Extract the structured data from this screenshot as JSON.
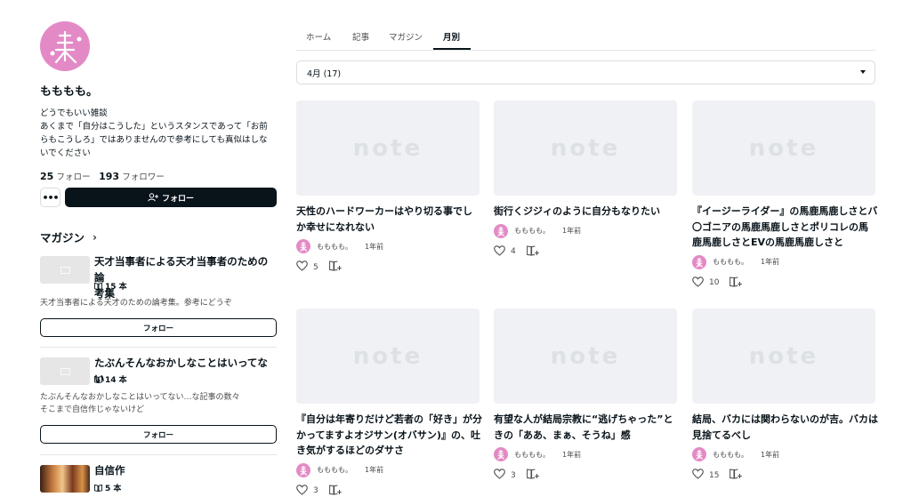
{
  "profile": {
    "name": "もももも。",
    "bio": [
      "どうでもいい雑談",
      "あくまで「自分はこうした」というスタンスであって「お前",
      "らもこうしろ」ではありませんので参考にしても真似はしな",
      "いでください"
    ],
    "following_count": "25",
    "following_label": "フォロー",
    "follower_count": "193",
    "follower_label": "フォロワー",
    "more_label": "•••",
    "follow_label": "フォロー"
  },
  "magazines": {
    "heading": "マガジン",
    "items": [
      {
        "title": [
          "天才当事者による天才当事者のための論",
          "考集"
        ],
        "count": "15 本",
        "desc": [
          "天才当事者による天才のための論考集。参考にどうぞ"
        ],
        "follow_label": "フォロー"
      },
      {
        "title": [
          "たぶんそんなおかしなことはいってない"
        ],
        "count": "14 本",
        "desc": [
          "たぶんそんなおかしなことはいってない…な記事の数々",
          "そこまで自信作じゃないけど"
        ],
        "follow_label": "フォロー"
      },
      {
        "title": [
          "自信作"
        ],
        "count": "5 本"
      }
    ]
  },
  "tabs": [
    {
      "label": "ホーム"
    },
    {
      "label": "記事"
    },
    {
      "label": "マガジン"
    },
    {
      "label": "月別"
    }
  ],
  "month_select": {
    "value": "4月 (17)"
  },
  "thumb_logo": "note",
  "articles": [
    {
      "title": [
        "天性のハードワーカーはやり切る事でし",
        "か幸せになれない"
      ],
      "author": "もももも。",
      "time": "1年前",
      "likes": "5"
    },
    {
      "title": [
        "街行くジジィのように自分もなりたい"
      ],
      "author": "もももも。",
      "time": "1年前",
      "likes": "4"
    },
    {
      "title": [
        "『イージーライダー』の馬鹿馬鹿しさとバ",
        "〇ゴニアの馬鹿馬鹿しさとポリコレの馬",
        "鹿馬鹿しさとEVの馬鹿馬鹿しさと"
      ],
      "author": "もももも。",
      "time": "1年前",
      "likes": "10"
    },
    {
      "title": [
        "『自分は年寄りだけど若者の「好き」が分",
        "かってますよオジサン(オバサン)』の、吐",
        "き気がするほどのダサさ"
      ],
      "author": "もももも。",
      "time": "1年前",
      "likes": "3"
    },
    {
      "title": [
        "有望な人が結局宗教に“逃げちゃった”と",
        "きの「ああ、まぁ、そうね」感"
      ],
      "author": "もももも。",
      "time": "1年前",
      "likes": "3"
    },
    {
      "title": [
        "結局、バカには関わらないのが吉。バカは",
        "見捨てるべし"
      ],
      "author": "もももも。",
      "time": "1年前",
      "likes": "15"
    }
  ],
  "colors": {
    "accent": "#08131a",
    "avatar": "#e38ac6",
    "thumb_bg": "#eff1f4"
  }
}
